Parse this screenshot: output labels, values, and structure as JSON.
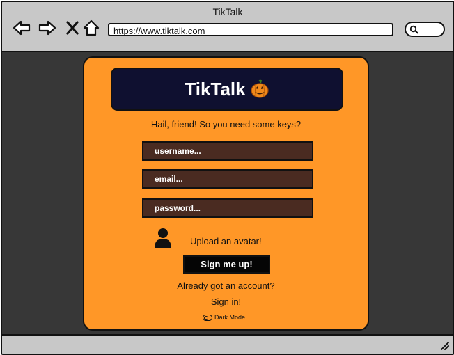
{
  "window": {
    "title": "TikTalk"
  },
  "browser": {
    "url": "https://www.tiktalk.com"
  },
  "card": {
    "brand": "TikTalk",
    "greeting": "Hail, friend! So you need some keys?",
    "fields": {
      "username_placeholder": "username...",
      "email_placeholder": "email...",
      "password_placeholder": "password..."
    },
    "upload_label": "Upload an avatar!",
    "signup_label": "Sign me up!",
    "already_text": "Already got an account?",
    "signin_label": "Sign in!",
    "darkmode_label": "Dark Mode"
  },
  "colors": {
    "card": "#ff9727",
    "banner": "#0f1030",
    "field": "#4a2b21",
    "viewport": "#373737"
  }
}
